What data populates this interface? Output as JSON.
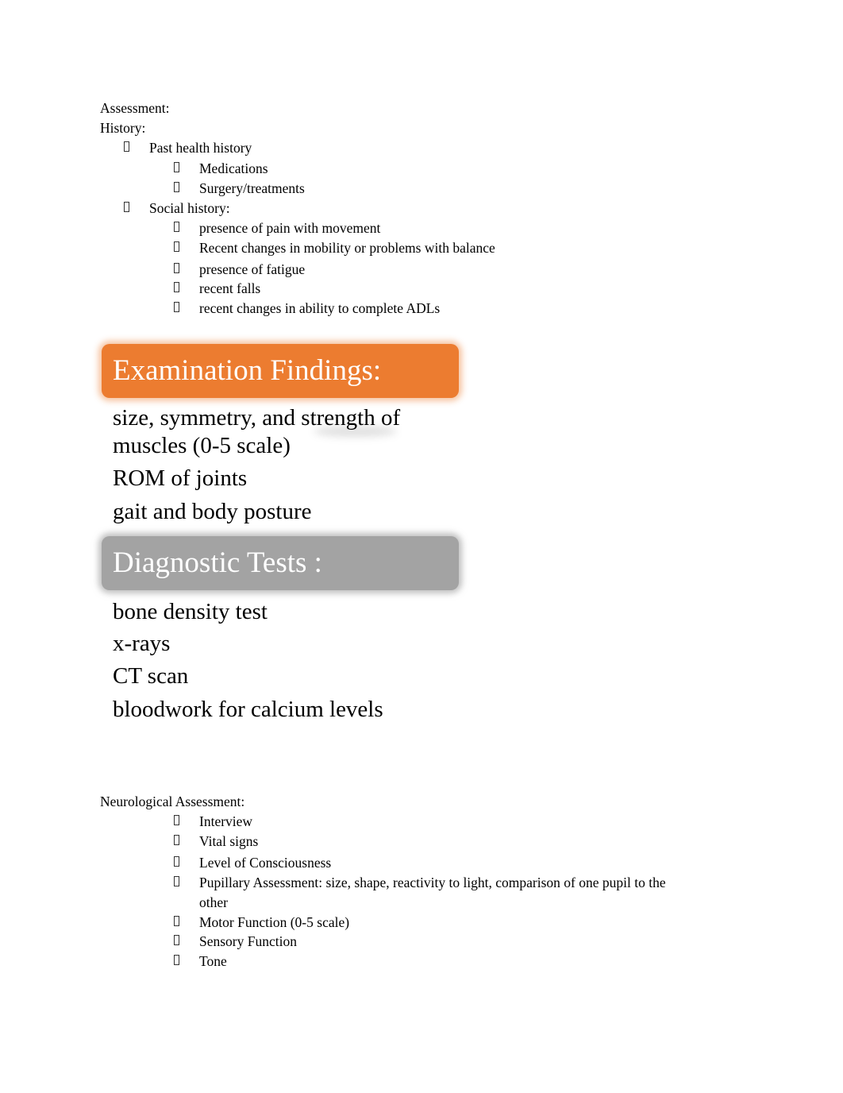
{
  "assessment": {
    "title": "Assessment:",
    "history_label": "History:",
    "groups": [
      {
        "label": "Past health history",
        "items": [
          "Medications",
          "Surgery/treatments"
        ]
      },
      {
        "label": "Social history:",
        "items": [
          "presence of pain with movement",
          "Recent changes in mobility or problems with balance",
          "presence of fatigue",
          "recent falls",
          "recent changes in ability to complete ADLs"
        ]
      }
    ]
  },
  "examination": {
    "heading": "Examination Findings:",
    "color": "#ec7c30",
    "items": [
      "size, symmetry, and strength  of",
      "muscles (0-5 scale)",
      "ROM of joints",
      "gait and body posture"
    ]
  },
  "diagnostics": {
    "heading": "Diagnostic Tests :",
    "color": "#a3a3a3",
    "items": [
      "bone density test",
      "x-rays",
      "CT scan",
      "bloodwork for calcium levels"
    ]
  },
  "neurological": {
    "title": "Neurological Assessment:",
    "items": [
      "Interview",
      "Vital signs",
      "Level of Consciousness",
      "Pupillary Assessment: size, shape, reactivity to light, comparison of one pupil to the",
      "other",
      "Motor Function (0-5 scale)",
      "Sensory Function",
      "Tone"
    ]
  },
  "icons": {
    "bullet": "missing-glyph-bullet-icon"
  }
}
